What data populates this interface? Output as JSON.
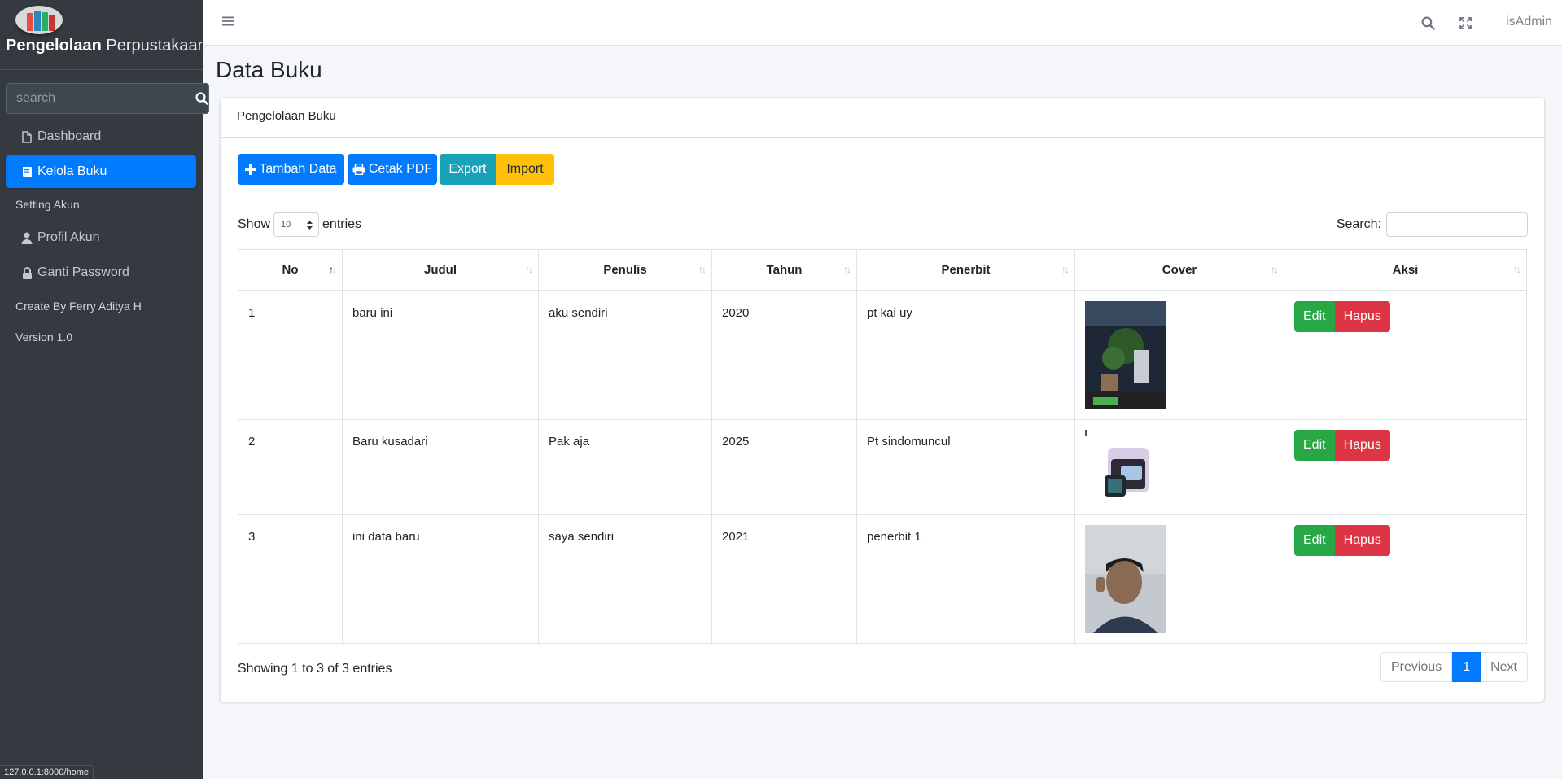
{
  "sidebar": {
    "brand_bold": "Pengelolaan",
    "brand_light": "Perpustakaan",
    "search_placeholder": "search",
    "items": [
      {
        "label": "Dashboard",
        "icon": "file-icon"
      },
      {
        "label": "Kelola Buku",
        "icon": "book-icon",
        "active": true
      }
    ],
    "header_setting": "Setting Akun",
    "setting_items": [
      {
        "label": "Profil Akun",
        "icon": "user-icon"
      },
      {
        "label": "Ganti Password",
        "icon": "lock-icon"
      }
    ],
    "credit": "Create By Ferry Aditya H",
    "version": "Version 1.0"
  },
  "navbar": {
    "user": "isAdmin",
    "icons": [
      "bars-icon",
      "search-icon",
      "expand-icon"
    ]
  },
  "page": {
    "title": "Data Buku",
    "card_title": "Pengelolaan Buku"
  },
  "toolbar": {
    "add_label": "Tambah Data",
    "pdf_label": "Cetak PDF",
    "export_label": "Export",
    "import_label": "Import"
  },
  "datatable": {
    "show_label": "Show",
    "page_length": "10",
    "entries_label": "entries",
    "search_label": "Search:",
    "columns": [
      "No",
      "Judul",
      "Penulis",
      "Tahun",
      "Penerbit",
      "Cover",
      "Aksi"
    ],
    "rows": [
      {
        "no": "1",
        "judul": "baru ini",
        "penulis": "aku sendiri",
        "tahun": "2020",
        "penerbit": "pt kai uy"
      },
      {
        "no": "2",
        "judul": "Baru kusadari",
        "penulis": "Pak aja",
        "tahun": "2025",
        "penerbit": "Pt sindomuncul"
      },
      {
        "no": "3",
        "judul": "ini data baru",
        "penulis": "saya sendiri",
        "tahun": "2021",
        "penerbit": "penerbit 1"
      }
    ],
    "edit_label": "Edit",
    "delete_label": "Hapus",
    "info": "Showing 1 to 3 of 3 entries",
    "prev_label": "Previous",
    "current_page": "1",
    "next_label": "Next"
  },
  "status_url": "127.0.0.1:8000/home",
  "colors": {
    "sidebar_bg": "#343a40",
    "primary": "#007bff",
    "info": "#17a2b8",
    "warning": "#ffc107",
    "success": "#28a745",
    "danger": "#dc3545"
  }
}
